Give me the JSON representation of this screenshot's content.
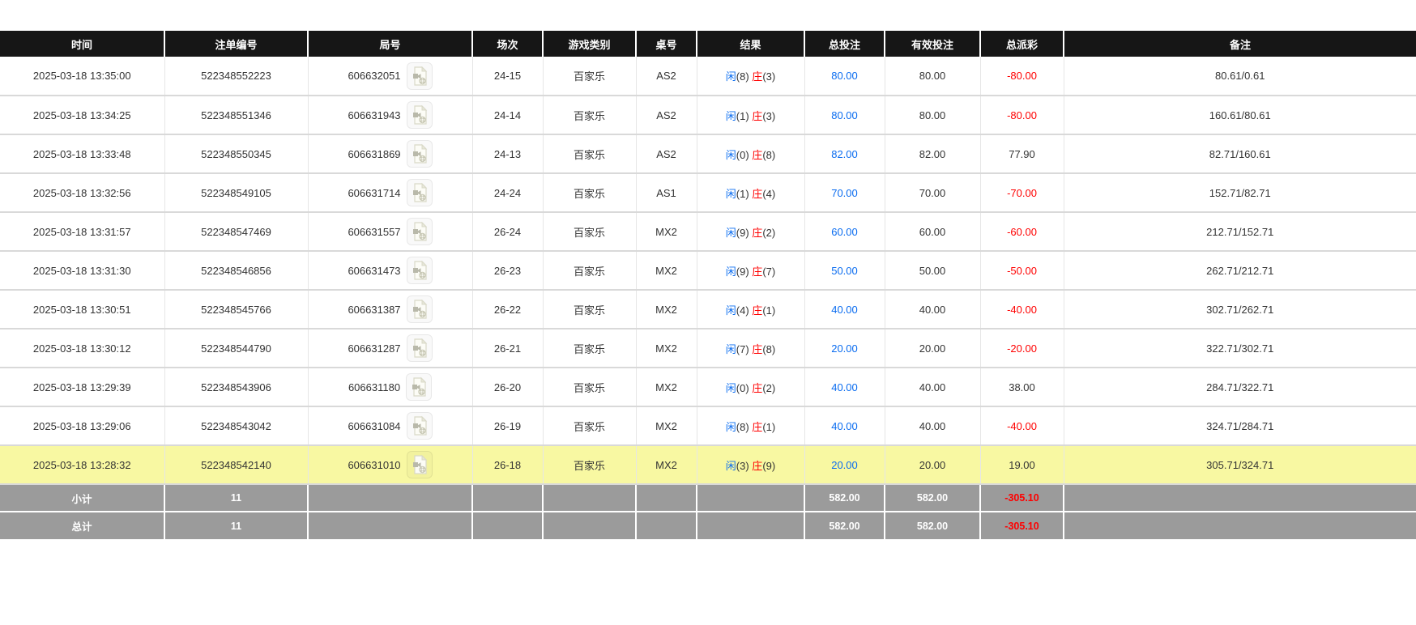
{
  "colors": {
    "header_bg": "#161616",
    "header_text": "#ffffff",
    "body_text": "#333333",
    "player_blue": "#0a6cf0",
    "banker_red": "#ff0000",
    "total_bet_blue": "#0a6cf0",
    "negative_payout_red": "#ff0000",
    "highlight_row_yellow": "#f8f8a2",
    "summary_row_gray": "#9b9b9b"
  },
  "icons": {
    "video_icon": "video-file-icon"
  },
  "table": {
    "columns": [
      {
        "key": "time",
        "label": "时间"
      },
      {
        "key": "bet-no",
        "label": "注单编号"
      },
      {
        "key": "round-no",
        "label": "局号"
      },
      {
        "key": "session",
        "label": "场次"
      },
      {
        "key": "game-type",
        "label": "游戏类别"
      },
      {
        "key": "table-no",
        "label": "桌号"
      },
      {
        "key": "result",
        "label": "结果"
      },
      {
        "key": "total-bet",
        "label": "总投注"
      },
      {
        "key": "valid-bet",
        "label": "有效投注"
      },
      {
        "key": "payout",
        "label": "总派彩"
      },
      {
        "key": "remark",
        "label": "备注"
      }
    ],
    "rows": [
      {
        "time": "2025-03-18 13:35:00",
        "bet_no": "522348552223",
        "round_no": "606632051",
        "session": "24-15",
        "game": "百家乐",
        "table_no": "AS2",
        "result": {
          "player": "闲",
          "player_pts": "(8)",
          "banker": "庄",
          "banker_pts": "(3)"
        },
        "total_bet": "80.00",
        "valid_bet": "80.00",
        "payout": "-80.00",
        "payout_negative": true,
        "remark": "80.61/0.61",
        "highlight": false
      },
      {
        "time": "2025-03-18 13:34:25",
        "bet_no": "522348551346",
        "round_no": "606631943",
        "session": "24-14",
        "game": "百家乐",
        "table_no": "AS2",
        "result": {
          "player": "闲",
          "player_pts": "(1)",
          "banker": "庄",
          "banker_pts": "(3)"
        },
        "total_bet": "80.00",
        "valid_bet": "80.00",
        "payout": "-80.00",
        "payout_negative": true,
        "remark": "160.61/80.61",
        "highlight": false
      },
      {
        "time": "2025-03-18 13:33:48",
        "bet_no": "522348550345",
        "round_no": "606631869",
        "session": "24-13",
        "game": "百家乐",
        "table_no": "AS2",
        "result": {
          "player": "闲",
          "player_pts": "(0)",
          "banker": "庄",
          "banker_pts": "(8)"
        },
        "total_bet": "82.00",
        "valid_bet": "82.00",
        "payout": "77.90",
        "payout_negative": false,
        "remark": "82.71/160.61",
        "highlight": false
      },
      {
        "time": "2025-03-18 13:32:56",
        "bet_no": "522348549105",
        "round_no": "606631714",
        "session": "24-24",
        "game": "百家乐",
        "table_no": "AS1",
        "result": {
          "player": "闲",
          "player_pts": "(1)",
          "banker": "庄",
          "banker_pts": "(4)"
        },
        "total_bet": "70.00",
        "valid_bet": "70.00",
        "payout": "-70.00",
        "payout_negative": true,
        "remark": "152.71/82.71",
        "highlight": false
      },
      {
        "time": "2025-03-18 13:31:57",
        "bet_no": "522348547469",
        "round_no": "606631557",
        "session": "26-24",
        "game": "百家乐",
        "table_no": "MX2",
        "result": {
          "player": "闲",
          "player_pts": "(9)",
          "banker": "庄",
          "banker_pts": "(2)"
        },
        "total_bet": "60.00",
        "valid_bet": "60.00",
        "payout": "-60.00",
        "payout_negative": true,
        "remark": "212.71/152.71",
        "highlight": false
      },
      {
        "time": "2025-03-18 13:31:30",
        "bet_no": "522348546856",
        "round_no": "606631473",
        "session": "26-23",
        "game": "百家乐",
        "table_no": "MX2",
        "result": {
          "player": "闲",
          "player_pts": "(9)",
          "banker": "庄",
          "banker_pts": "(7)"
        },
        "total_bet": "50.00",
        "valid_bet": "50.00",
        "payout": "-50.00",
        "payout_negative": true,
        "remark": "262.71/212.71",
        "highlight": false
      },
      {
        "time": "2025-03-18 13:30:51",
        "bet_no": "522348545766",
        "round_no": "606631387",
        "session": "26-22",
        "game": "百家乐",
        "table_no": "MX2",
        "result": {
          "player": "闲",
          "player_pts": "(4)",
          "banker": "庄",
          "banker_pts": "(1)"
        },
        "total_bet": "40.00",
        "valid_bet": "40.00",
        "payout": "-40.00",
        "payout_negative": true,
        "remark": "302.71/262.71",
        "highlight": false
      },
      {
        "time": "2025-03-18 13:30:12",
        "bet_no": "522348544790",
        "round_no": "606631287",
        "session": "26-21",
        "game": "百家乐",
        "table_no": "MX2",
        "result": {
          "player": "闲",
          "player_pts": "(7)",
          "banker": "庄",
          "banker_pts": "(8)"
        },
        "total_bet": "20.00",
        "valid_bet": "20.00",
        "payout": "-20.00",
        "payout_negative": true,
        "remark": "322.71/302.71",
        "highlight": false
      },
      {
        "time": "2025-03-18 13:29:39",
        "bet_no": "522348543906",
        "round_no": "606631180",
        "session": "26-20",
        "game": "百家乐",
        "table_no": "MX2",
        "result": {
          "player": "闲",
          "player_pts": "(0)",
          "banker": "庄",
          "banker_pts": "(2)"
        },
        "total_bet": "40.00",
        "valid_bet": "40.00",
        "payout": "38.00",
        "payout_negative": false,
        "remark": "284.71/322.71",
        "highlight": false
      },
      {
        "time": "2025-03-18 13:29:06",
        "bet_no": "522348543042",
        "round_no": "606631084",
        "session": "26-19",
        "game": "百家乐",
        "table_no": "MX2",
        "result": {
          "player": "闲",
          "player_pts": "(8)",
          "banker": "庄",
          "banker_pts": "(1)"
        },
        "total_bet": "40.00",
        "valid_bet": "40.00",
        "payout": "-40.00",
        "payout_negative": true,
        "remark": "324.71/284.71",
        "highlight": false
      },
      {
        "time": "2025-03-18 13:28:32",
        "bet_no": "522348542140",
        "round_no": "606631010",
        "session": "26-18",
        "game": "百家乐",
        "table_no": "MX2",
        "result": {
          "player": "闲",
          "player_pts": "(3)",
          "banker": "庄",
          "banker_pts": "(9)"
        },
        "total_bet": "20.00",
        "valid_bet": "20.00",
        "payout": "19.00",
        "payout_negative": false,
        "remark": "305.71/324.71",
        "highlight": true
      }
    ],
    "summary": [
      {
        "label": "小计",
        "count": "11",
        "total_bet": "582.00",
        "valid_bet": "582.00",
        "payout": "-305.10",
        "payout_negative": true
      },
      {
        "label": "总计",
        "count": "11",
        "total_bet": "582.00",
        "valid_bet": "582.00",
        "payout": "-305.10",
        "payout_negative": true
      }
    ]
  }
}
